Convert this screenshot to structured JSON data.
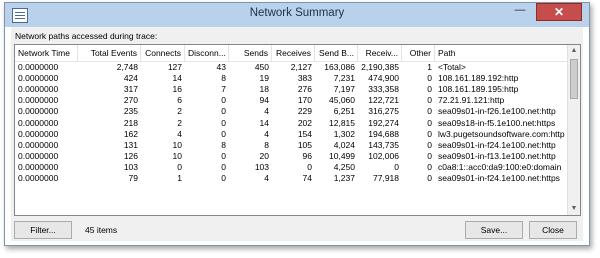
{
  "window": {
    "title": "Network Summary",
    "minimize": "—",
    "close": "✕"
  },
  "section_label": "Network paths accessed during trace:",
  "columns": [
    "Network Time",
    "Total Events",
    "Connects",
    "Disconn...",
    "Sends",
    "Receives",
    "Send B...",
    "Receiv...",
    "Other",
    "Path"
  ],
  "rows": [
    [
      "0.0000000",
      "2,748",
      "127",
      "43",
      "450",
      "2,127",
      "163,086",
      "2,190,385",
      "1",
      "<Total>"
    ],
    [
      "0.0000000",
      "424",
      "14",
      "8",
      "19",
      "383",
      "7,231",
      "474,900",
      "0",
      "108.161.189.192:http"
    ],
    [
      "0.0000000",
      "317",
      "16",
      "7",
      "18",
      "276",
      "7,197",
      "333,358",
      "0",
      "108.161.189.195:http"
    ],
    [
      "0.0000000",
      "270",
      "6",
      "0",
      "94",
      "170",
      "45,060",
      "122,721",
      "0",
      "72.21.91.121:http"
    ],
    [
      "0.0000000",
      "235",
      "2",
      "0",
      "4",
      "229",
      "6,251",
      "316,275",
      "0",
      "sea09s01-in-f26.1e100.net:http"
    ],
    [
      "0.0000000",
      "218",
      "2",
      "0",
      "14",
      "202",
      "12,815",
      "192,274",
      "0",
      "sea09s18-in-f5.1e100.net:https"
    ],
    [
      "0.0000000",
      "162",
      "4",
      "0",
      "4",
      "154",
      "1,302",
      "194,688",
      "0",
      "lw3.pugetsoundsoftware.com:http"
    ],
    [
      "0.0000000",
      "131",
      "10",
      "8",
      "8",
      "105",
      "4,024",
      "143,735",
      "0",
      "sea09s01-in-f24.1e100.net:http"
    ],
    [
      "0.0000000",
      "126",
      "10",
      "0",
      "20",
      "96",
      "10,499",
      "102,006",
      "0",
      "sea09s01-in-f13.1e100.net:http"
    ],
    [
      "0.0000000",
      "103",
      "0",
      "0",
      "103",
      "0",
      "4,250",
      "0",
      "0",
      "c0a8:1::acc0:da9:100:e0:domain"
    ],
    [
      "0.0000000",
      "79",
      "1",
      "0",
      "4",
      "74",
      "1,237",
      "77,918",
      "0",
      "sea09s01-in-f24.1e100.net:https"
    ]
  ],
  "buttons": {
    "filter": "Filter...",
    "save": "Save...",
    "close": "Close"
  },
  "items_count": "45 items"
}
